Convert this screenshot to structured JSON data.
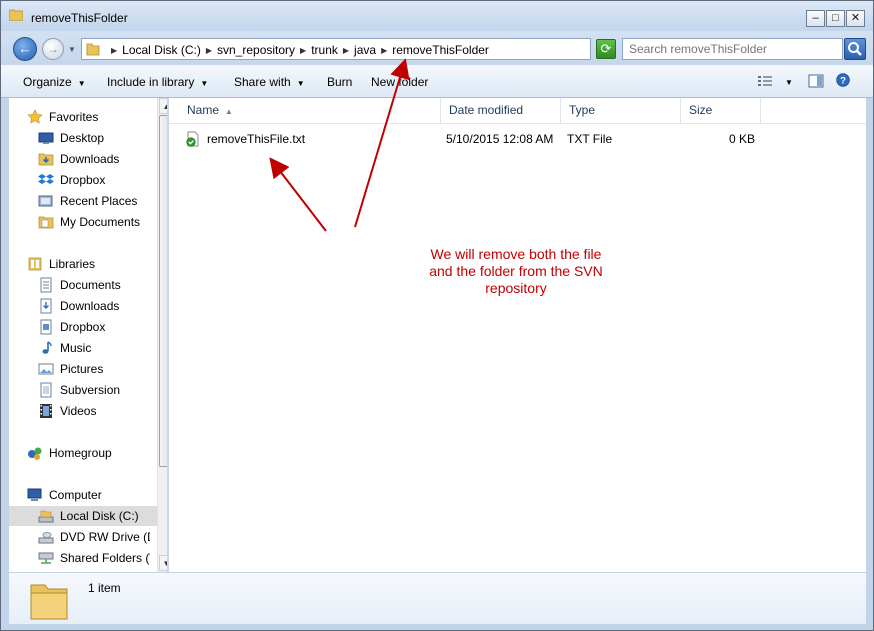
{
  "window": {
    "title": "removeThisFolder",
    "minimize_glyph": "–",
    "maximize_glyph": "□",
    "close_glyph": "✕"
  },
  "navigation": {
    "back_glyph": "←",
    "forward_glyph": "→",
    "breadcrumbs": [
      "Local Disk (C:)",
      "svn_repository",
      "trunk",
      "java",
      "removeThisFolder"
    ],
    "refresh_glyph": "⟳",
    "search_placeholder": "Search removeThisFolder"
  },
  "toolbar": {
    "organize": "Organize",
    "include_in_library": "Include in library",
    "share_with": "Share with",
    "burn": "Burn",
    "new_folder": "New folder"
  },
  "sidebar": {
    "favorites": {
      "header": "Favorites",
      "items": [
        "Desktop",
        "Downloads",
        "Dropbox",
        "Recent Places",
        "My Documents"
      ]
    },
    "libraries": {
      "header": "Libraries",
      "items": [
        "Documents",
        "Downloads",
        "Dropbox",
        "Music",
        "Pictures",
        "Subversion",
        "Videos"
      ]
    },
    "homegroup": "Homegroup",
    "computer": {
      "header": "Computer",
      "items": [
        "Local Disk (C:)",
        "DVD RW Drive (D",
        "Shared Folders (\\"
      ]
    },
    "selected_item": "Local Disk (C:)"
  },
  "file_list": {
    "columns": [
      "Name",
      "Date modified",
      "Type",
      "Size"
    ],
    "sorted_by": "Name",
    "rows": [
      {
        "name": "removeThisFile.txt",
        "date_modified": "5/10/2015 12:08 AM",
        "type": "TXT File",
        "size": "0 KB"
      }
    ]
  },
  "annotation": {
    "text": "We will remove both the file and the folder from the SVN repository",
    "color": "#c00000"
  },
  "details": {
    "item_count": "1 item"
  },
  "colors": {
    "chrome": "#c2d4ea",
    "selection": "#dcdcdc",
    "header_text": "#1e395b"
  }
}
